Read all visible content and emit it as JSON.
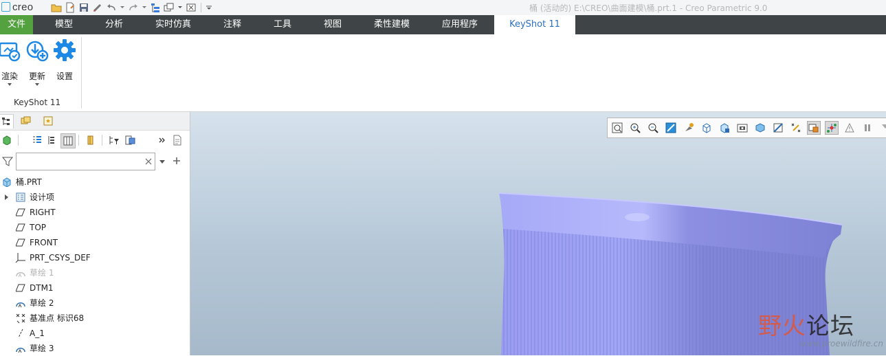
{
  "app": {
    "logo_text": "creo",
    "window_title": "桶 (活动的) E:\\CREO\\曲面建模\\桶.prt.1 - Creo Parametric 9.0"
  },
  "menu_tabs": [
    "文件",
    "模型",
    "分析",
    "实时仿真",
    "注释",
    "工具",
    "视图",
    "柔性建模",
    "应用程序",
    "KeyShot 11"
  ],
  "active_tab": "KeyShot 11",
  "ribbon": {
    "buttons": [
      {
        "label": "渲染",
        "icon": "render-icon"
      },
      {
        "label": "更新",
        "icon": "update-icon"
      },
      {
        "label": "设置",
        "icon": "gear-icon"
      }
    ],
    "group_label": "KeyShot 11"
  },
  "panel": {
    "filter": {
      "value": "",
      "placeholder": ""
    },
    "tree": [
      {
        "label": "桶.PRT",
        "icon": "part-icon",
        "dim": false
      },
      {
        "label": "设计项",
        "icon": "design-items-icon",
        "dim": false,
        "expandable": true
      },
      {
        "label": "RIGHT",
        "icon": "datum-plane-icon",
        "dim": false
      },
      {
        "label": "TOP",
        "icon": "datum-plane-icon",
        "dim": false
      },
      {
        "label": "FRONT",
        "icon": "datum-plane-icon",
        "dim": false
      },
      {
        "label": "PRT_CSYS_DEF",
        "icon": "csys-icon",
        "dim": false
      },
      {
        "label": "草绘 1",
        "icon": "sketch-icon",
        "dim": true
      },
      {
        "label": "DTM1",
        "icon": "datum-plane-icon",
        "dim": false
      },
      {
        "label": "草绘 2",
        "icon": "sketch-icon",
        "dim": false
      },
      {
        "label": "基准点 标识68",
        "icon": "datum-point-icon",
        "dim": false
      },
      {
        "label": "A_1",
        "icon": "axis-icon",
        "dim": false
      },
      {
        "label": "草绘 3",
        "icon": "sketch-icon",
        "dim": false
      }
    ]
  },
  "colors": {
    "tab_bar": "#3f4547",
    "file_tab": "#53a23f",
    "active_tab_text": "#2c6fbf",
    "model_surface": "#8f93e0",
    "viewport_top": "#d6e2ec",
    "viewport_bottom": "#a6b9ca"
  },
  "watermark": {
    "text_a": "野火",
    "text_b": "论坛",
    "url": "www.proewildfire.cn"
  }
}
